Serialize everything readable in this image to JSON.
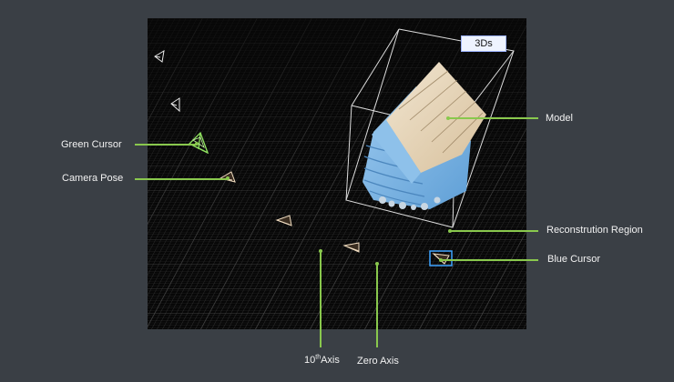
{
  "view_mode_badge": "3Ds",
  "callouts": {
    "green_cursor": "Green Cursor",
    "camera_pose": "Camera Pose",
    "model": "Model",
    "reconstruction_region": "Reconstrution Region",
    "blue_cursor": "Blue Cursor",
    "tenth_axis_prefix": "10",
    "tenth_axis_sup": "th",
    "tenth_axis_suffix": "Axis",
    "zero_axis": "Zero Axis"
  },
  "colors": {
    "background": "#3a3f45",
    "viewport": "#070707",
    "grid": "#3b3b3b",
    "leader": "#89c84d",
    "green_cursor": "#8fe35f",
    "blue_cursor": "#3ea4ff",
    "model_body": "#78b7e9",
    "model_roof": "#e5d4b7",
    "badge_bg": "#eef3ff",
    "badge_border": "#9db3ff"
  },
  "icons": {
    "camera_pose_icon": "camera-frustum-icon",
    "green_cursor_icon": "camera-frustum-green-icon",
    "blue_cursor_icon": "camera-frustum-blue-icon"
  }
}
